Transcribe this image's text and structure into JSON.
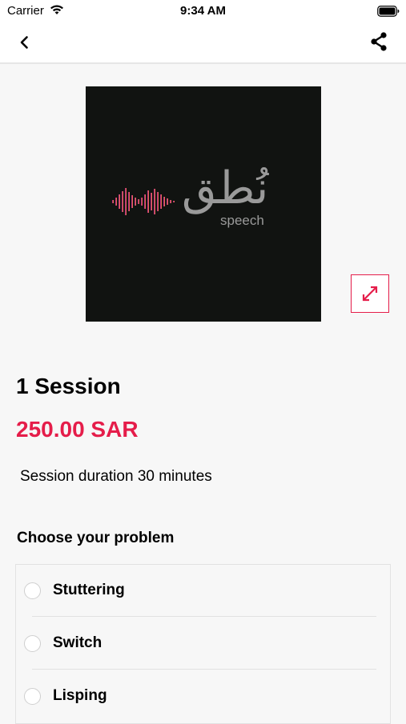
{
  "status_bar": {
    "carrier": "Carrier",
    "time": "9:34 AM"
  },
  "nav": {
    "back_icon": "chevron-left-icon",
    "share_icon": "share-icon"
  },
  "product": {
    "image": {
      "logo_arabic": "نُطق",
      "logo_subtitle": "speech"
    },
    "expand_icon": "expand-arrows-icon",
    "title": "1 Session",
    "price": "250.00 SAR",
    "duration": "Session duration 30 minutes"
  },
  "problems": {
    "heading": "Choose your problem",
    "options": [
      {
        "label": "Stuttering"
      },
      {
        "label": "Switch"
      },
      {
        "label": "Lisping"
      }
    ]
  },
  "colors": {
    "accent": "#e51d4a",
    "background": "#f7f7f7"
  }
}
